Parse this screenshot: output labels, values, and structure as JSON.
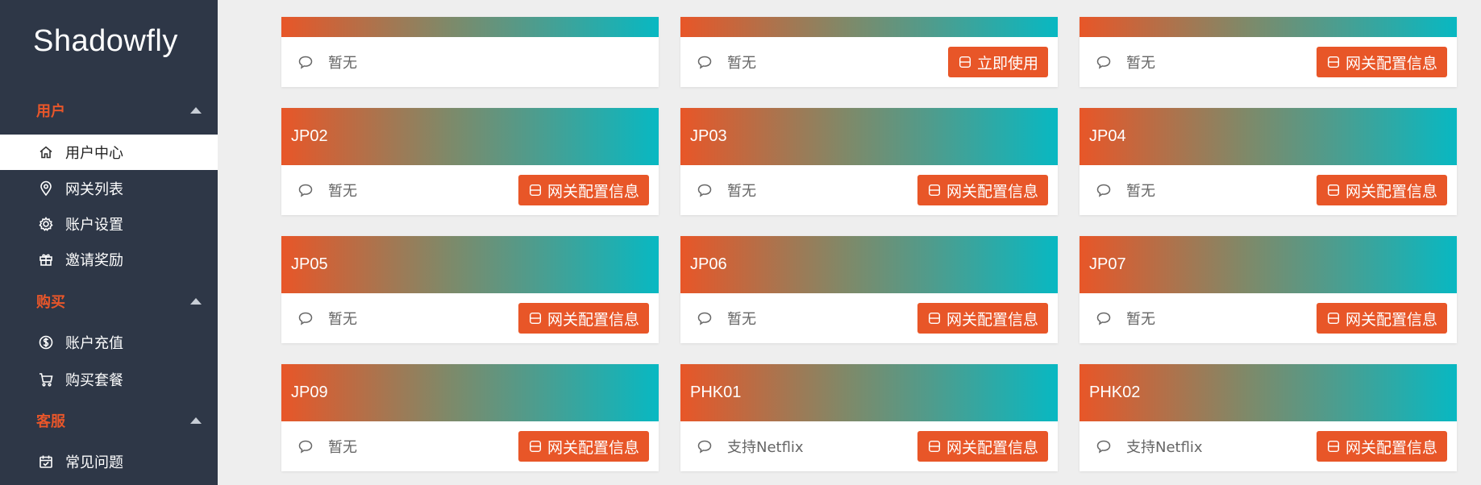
{
  "sidebar": {
    "brand": "Shadowfly",
    "sections": [
      {
        "title": "用户",
        "items": [
          {
            "label": "用户中心",
            "icon": "home-icon",
            "active": true
          },
          {
            "label": "网关列表",
            "icon": "location-pin-icon"
          },
          {
            "label": "账户设置",
            "icon": "gear-icon"
          },
          {
            "label": "邀请奖励",
            "icon": "gift-icon"
          }
        ]
      },
      {
        "title": "购买",
        "items": [
          {
            "label": "账户充值",
            "icon": "dollar-coin-icon"
          },
          {
            "label": "购买套餐",
            "icon": "shopping-cart-icon"
          }
        ]
      },
      {
        "title": "客服",
        "items": [
          {
            "label": "常见问题",
            "icon": "calendar-check-icon"
          }
        ]
      }
    ]
  },
  "cards": [
    {
      "title": "",
      "note": "暂无",
      "button": ""
    },
    {
      "title": "",
      "note": "暂无",
      "button": "立即使用"
    },
    {
      "title": "",
      "note": "暂无",
      "button": "网关配置信息"
    },
    {
      "title": "JP02",
      "note": "暂无",
      "button": "网关配置信息"
    },
    {
      "title": "JP03",
      "note": "暂无",
      "button": "网关配置信息"
    },
    {
      "title": "JP04",
      "note": "暂无",
      "button": "网关配置信息"
    },
    {
      "title": "JP05",
      "note": "暂无",
      "button": "网关配置信息"
    },
    {
      "title": "JP06",
      "note": "暂无",
      "button": "网关配置信息"
    },
    {
      "title": "JP07",
      "note": "暂无",
      "button": "网关配置信息"
    },
    {
      "title": "JP09",
      "note": "暂无",
      "button": "网关配置信息"
    },
    {
      "title": "PHK01",
      "note": "支持Netflix",
      "button": "网关配置信息"
    },
    {
      "title": "PHK02",
      "note": "支持Netflix",
      "button": "网关配置信息"
    }
  ],
  "colors": {
    "sidebar_bg": "#2e3747",
    "accent": "#e85628",
    "gradient_end": "#08b8c2",
    "page_bg": "#eeeeee"
  }
}
